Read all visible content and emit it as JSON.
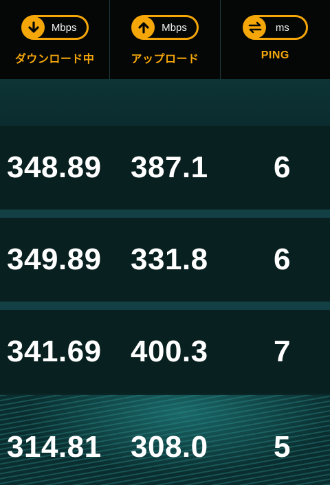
{
  "header": {
    "download": {
      "unit": "Mbps",
      "label": "ダウンロード中",
      "icon": "arrow-down-icon"
    },
    "upload": {
      "unit": "Mbps",
      "label": "アップロード",
      "icon": "arrow-up-icon"
    },
    "ping": {
      "unit": "ms",
      "label": "PING",
      "icon": "swap-arrows-icon"
    }
  },
  "results": [
    {
      "download": "348.89",
      "upload": "387.1",
      "ping": "6"
    },
    {
      "download": "349.89",
      "upload": "331.8",
      "ping": "6"
    },
    {
      "download": "341.69",
      "upload": "400.3",
      "ping": "7"
    },
    {
      "download": "314.81",
      "upload": "308.0",
      "ping": "5"
    }
  ],
  "colors": {
    "accent": "#f5a70a",
    "background": "#08201f",
    "header": "#050707"
  }
}
